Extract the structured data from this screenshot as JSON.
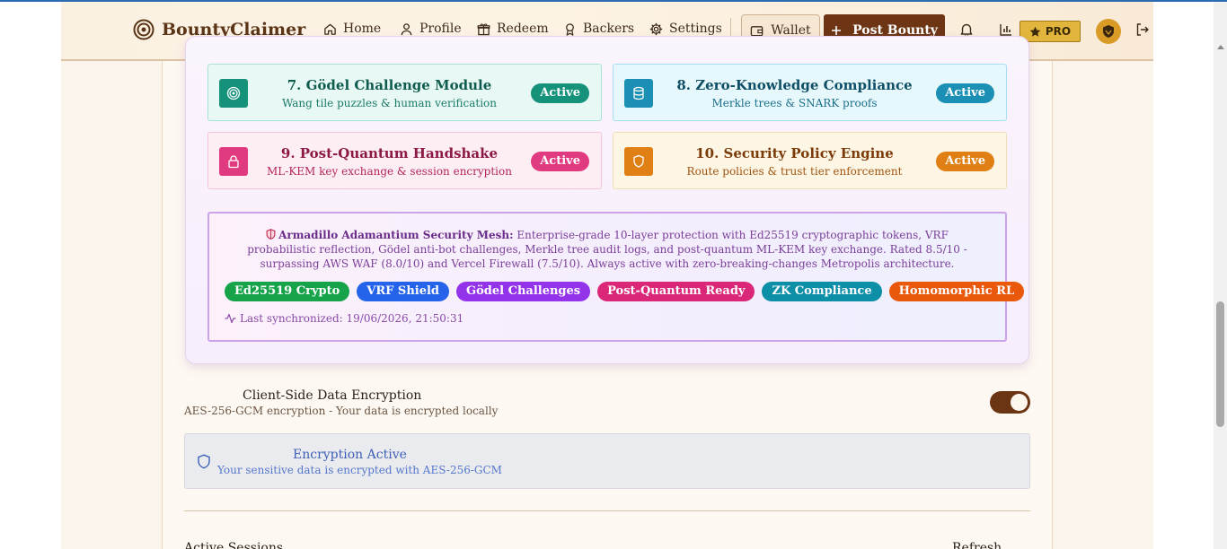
{
  "brand": {
    "name": "BountyClaimer"
  },
  "nav": {
    "home": "Home",
    "profile": "Profile",
    "redeem": "Redeem",
    "backers": "Backers",
    "settings": "Settings",
    "wallet": "Wallet",
    "post_bounty": "Post Bounty",
    "pro": "PRO"
  },
  "modules": [
    {
      "title": "7. Gödel Challenge Module",
      "subtitle": "Wang tile puzzles & human verification",
      "status": "Active",
      "icon": "target-icon",
      "color": "#16917a"
    },
    {
      "title": "8. Zero-Knowledge Compliance",
      "subtitle": "Merkle trees & SNARK proofs",
      "status": "Active",
      "icon": "database-icon",
      "color": "#1b8fb4"
    },
    {
      "title": "9. Post-Quantum Handshake",
      "subtitle": "ML-KEM key exchange & session encryption",
      "status": "Active",
      "icon": "lock-icon",
      "color": "#e03a80"
    },
    {
      "title": "10. Security Policy Engine",
      "subtitle": "Route policies & trust tier enforcement",
      "status": "Active",
      "icon": "shield-icon",
      "color": "#e08014"
    }
  ],
  "mesh": {
    "heading": "Armadillo Adamantium Security Mesh:",
    "description": "Enterprise-grade 10-layer protection with Ed25519 cryptographic tokens, VRF probabilistic reflection, Gödel anti-bot challenges, Merkle tree audit logs, and post-quantum ML-KEM key exchange. Rated 8.5/10 - surpassing AWS WAF (8.0/10) and Vercel Firewall (7.5/10). Always active with zero-breaking-changes Metropolis architecture.",
    "tags": [
      {
        "label": "Ed25519 Crypto",
        "color": "#16a34a"
      },
      {
        "label": "VRF Shield",
        "color": "#2563eb"
      },
      {
        "label": "Gödel Challenges",
        "color": "#9333ea"
      },
      {
        "label": "Post-Quantum Ready",
        "color": "#db2777"
      },
      {
        "label": "ZK Compliance",
        "color": "#0e8fa8"
      },
      {
        "label": "Homomorphic RL",
        "color": "#ea580c"
      }
    ],
    "last_sync": "Last synchronized: 19/06/2026, 21:50:31"
  },
  "encryption": {
    "title": "Client-Side Data Encryption",
    "subtitle": "AES-256-GCM encryption - Your data is encrypted locally",
    "enabled": true,
    "panel_title": "Encryption Active",
    "panel_subtitle": "Your sensitive data is encrypted with AES-256-GCM"
  },
  "next_section": {
    "title_partial": "Active Sessions",
    "action_partial": "Refresh"
  }
}
